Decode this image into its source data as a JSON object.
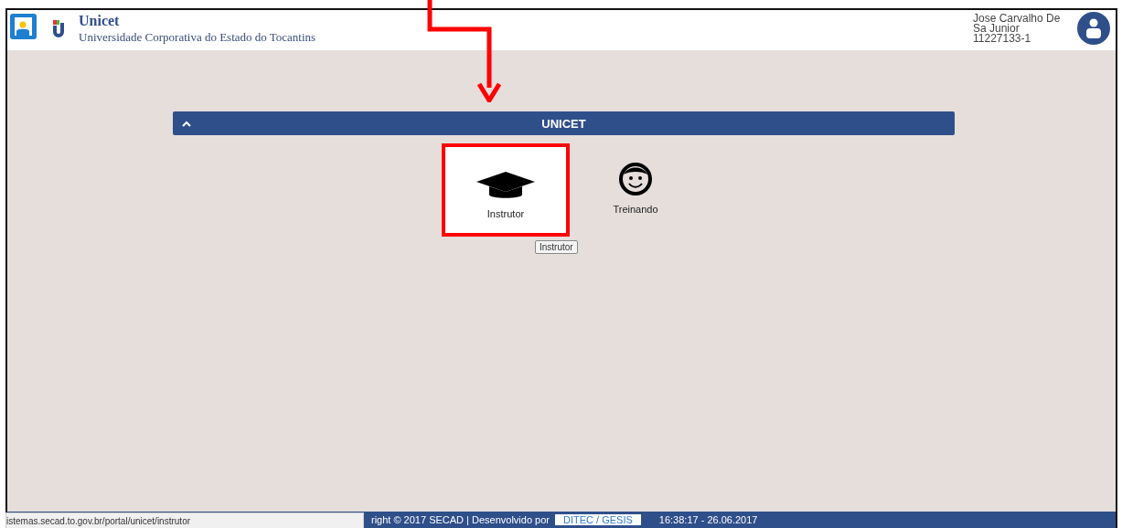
{
  "header": {
    "title": "Unicet",
    "subtitle": "Universidade Corporativa do Estado do Tocantins",
    "user": {
      "name": "Jose Carvalho De Sa Junior",
      "id": "11227133-1"
    }
  },
  "panel": {
    "title": "UNICET",
    "expanded": true,
    "tiles": [
      {
        "label": "Instrutor",
        "kind": "cap",
        "selected": true
      },
      {
        "label": "Treinando",
        "kind": "smile",
        "selected": false
      }
    ]
  },
  "tooltip": "Instrutor",
  "footer": {
    "copyright": "right © 2017 SECAD | Desenvolvido por",
    "link": "DITEC / GESIS",
    "timestamp": "16:38:17 - 26.06.2017"
  },
  "status_url": "istemas.secad.to.gov.br/portal/unicet/instrutor"
}
